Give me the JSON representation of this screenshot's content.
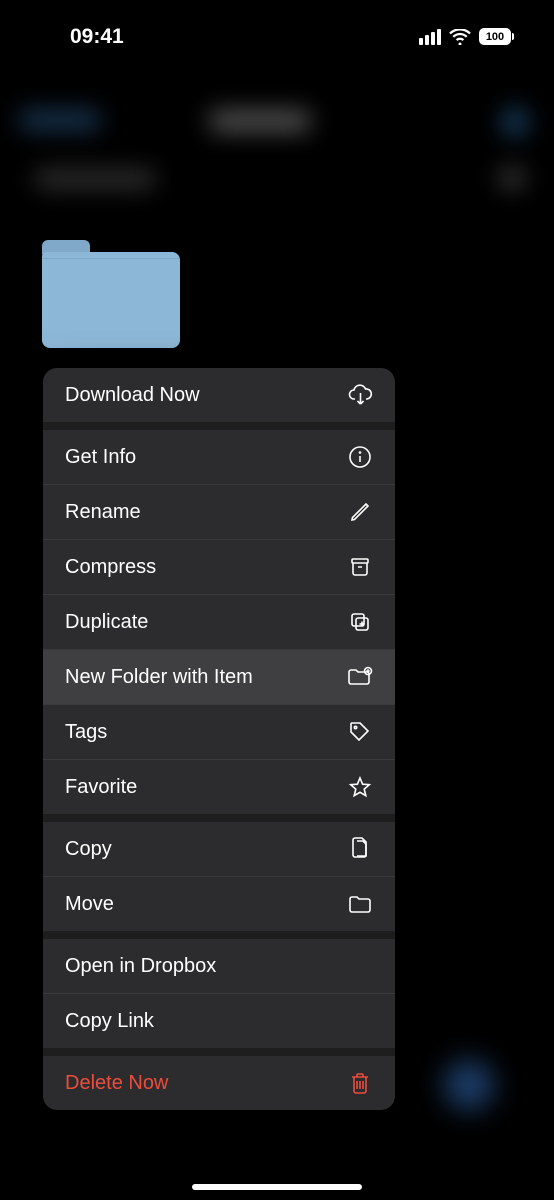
{
  "statusBar": {
    "time": "09:41",
    "battery": "100"
  },
  "menu": {
    "items": [
      {
        "label": "Download Now",
        "icon": "cloud-download-icon"
      },
      {
        "label": "Get Info",
        "icon": "info-icon"
      },
      {
        "label": "Rename",
        "icon": "pencil-icon"
      },
      {
        "label": "Compress",
        "icon": "archive-icon"
      },
      {
        "label": "Duplicate",
        "icon": "duplicate-icon"
      },
      {
        "label": "New Folder with Item",
        "icon": "folder-plus-icon",
        "highlighted": true
      },
      {
        "label": "Tags",
        "icon": "tag-icon"
      },
      {
        "label": "Favorite",
        "icon": "star-icon"
      },
      {
        "label": "Copy",
        "icon": "copy-doc-icon"
      },
      {
        "label": "Move",
        "icon": "folder-icon"
      },
      {
        "label": "Open in Dropbox",
        "icon": ""
      },
      {
        "label": "Copy Link",
        "icon": ""
      },
      {
        "label": "Delete Now",
        "icon": "trash-icon",
        "destructive": true
      }
    ]
  }
}
